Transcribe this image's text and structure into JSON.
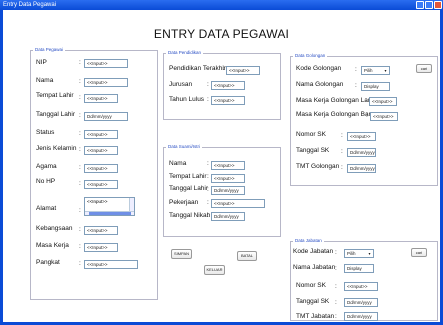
{
  "window": {
    "title": "Entry Data Pegawai"
  },
  "page_title": "ENTRY DATA PEGAWAI",
  "groups": {
    "pegawai": {
      "legend": "Data Pegawai",
      "fields": [
        {
          "label": "NIP",
          "value": "<<Input>>"
        },
        {
          "label": "Nama",
          "value": "<<Input>>"
        },
        {
          "label": "Tempat Lahir",
          "value": "<<Input>>"
        },
        {
          "label": "Tanggal Lahir",
          "value": "Dd/mm/yyyy"
        },
        {
          "label": "Status",
          "value": "<<Input>>"
        },
        {
          "label": "Jenis Kelamin",
          "value": "<<Input>>"
        },
        {
          "label": "Agama",
          "value": "<<Input>>"
        },
        {
          "label": "No HP",
          "value": "<<Input>>"
        },
        {
          "label": "Alamat",
          "value": "<<Input>>"
        },
        {
          "label": "Kebangsaan",
          "value": "<<Input>>"
        },
        {
          "label": "Masa Kerja",
          "value": "<<Input>>"
        },
        {
          "label": "Pangkat",
          "value": "<<Input>>"
        }
      ]
    },
    "pendidikan": {
      "legend": "Data Pendidikan",
      "fields": [
        {
          "label": "Pendidikan Terakhir",
          "value": "<<Input>>"
        },
        {
          "label": "Jurusan",
          "value": "<<Input>>"
        },
        {
          "label": "Tahun Lulus",
          "value": "<<Input>>"
        }
      ]
    },
    "suami_istri": {
      "legend": "Data Suami/Istri",
      "fields": [
        {
          "label": "Nama",
          "value": "<<Input>>"
        },
        {
          "label": "Tempat Lahir",
          "value": "<<Input>>"
        },
        {
          "label": "Tanggal Lahir",
          "value": "Dd/mm/yyyy"
        },
        {
          "label": "Pekerjaan",
          "value": "<<Input>>"
        },
        {
          "label": "Tanggal Nikah",
          "value": "Dd/mm/yyyy"
        }
      ]
    },
    "golongan": {
      "legend": "Data Golongan",
      "fields": [
        {
          "label": "Kode Golongan",
          "value": "Pilih"
        },
        {
          "label": "Nama Golongan",
          "value": "Display"
        },
        {
          "label": "Masa Kerja Golongan Lama",
          "value": "<<Input>>"
        },
        {
          "label": "Masa Kerja Golongan Baru",
          "value": "<<Input>>"
        },
        {
          "label": "Nomor SK",
          "value": "<<Input>>"
        },
        {
          "label": "Tanggal SK",
          "value": "Dd/mm/yyyy"
        },
        {
          "label": "TMT Golongan",
          "value": "Dd/mm/yyyy"
        }
      ],
      "search_label": "cari"
    },
    "jabatan": {
      "legend": "Data Jabatan",
      "fields": [
        {
          "label": "Kode Jabatan",
          "value": "Pilih"
        },
        {
          "label": "Nama Jabatan",
          "value": "Display"
        },
        {
          "label": "Nomor SK",
          "value": "<<Input>>"
        },
        {
          "label": "Tanggal SK",
          "value": "Dd/mm/yyyy"
        },
        {
          "label": "TMT Jabatan",
          "value": "Dd/mm/yyyy"
        }
      ],
      "search_label": "cari"
    }
  },
  "buttons": {
    "save": "SIMPAN",
    "cancel": "BATAL",
    "exit": "KELUAR"
  }
}
